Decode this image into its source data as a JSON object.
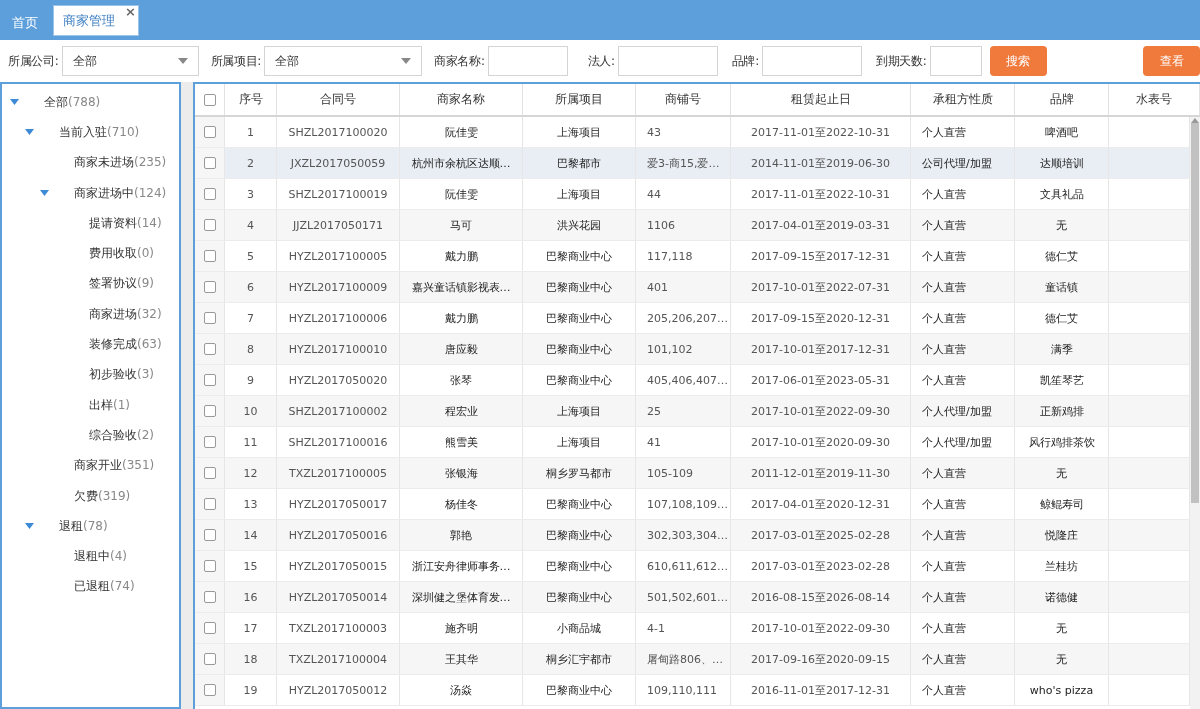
{
  "tabs": [
    {
      "label": "首页",
      "selected": false
    },
    {
      "label": "商家管理",
      "selected": true,
      "close": "×"
    }
  ],
  "filters": [
    {
      "kind": "select",
      "label": "所属公司:",
      "value": "全部"
    },
    {
      "kind": "select",
      "label": "所属项目:",
      "value": "全部"
    },
    {
      "kind": "input",
      "label": "商家名称:"
    },
    {
      "kind": "input",
      "label": "法人:"
    },
    {
      "kind": "input",
      "label": "品牌:"
    },
    {
      "kind": "short",
      "label": "到期天数:"
    }
  ],
  "search_button": "搜索",
  "view_button": "查看",
  "tree": [
    {
      "label": "全部",
      "count": "(788)",
      "expanded": true,
      "children": [
        {
          "label": "当前入驻",
          "count": "(710)",
          "expanded": true,
          "children": [
            {
              "label": "商家未进场",
              "count": "(235)"
            },
            {
              "label": "商家进场中",
              "count": "(124)",
              "expanded": true,
              "children": [
                {
                  "label": "提请资料",
                  "count": "(14)"
                },
                {
                  "label": "费用收取",
                  "count": "(0)"
                },
                {
                  "label": "签署协议",
                  "count": "(9)"
                },
                {
                  "label": "商家进场",
                  "count": "(32)"
                },
                {
                  "label": "装修完成",
                  "count": "(63)"
                },
                {
                  "label": "初步验收",
                  "count": "(3)"
                },
                {
                  "label": "出样",
                  "count": "(1)"
                },
                {
                  "label": "综合验收",
                  "count": "(2)"
                }
              ]
            },
            {
              "label": "商家开业",
              "count": "(351)"
            },
            {
              "label": "欠费",
              "count": "(319)"
            }
          ]
        },
        {
          "label": "退租",
          "count": "(78)",
          "expanded": true,
          "children": [
            {
              "label": "退租中",
              "count": "(4)"
            },
            {
              "label": "已退租",
              "count": "(74)"
            }
          ]
        }
      ]
    }
  ],
  "table": {
    "header_checked": false,
    "columns": [
      "序号",
      "合同号",
      "商家名称",
      "所属项目",
      "商铺号",
      "租赁起止日",
      "承租方性质",
      "品牌",
      "水表号"
    ],
    "rows": [
      {
        "checked": false,
        "selected": false,
        "cells": [
          "1",
          "SHZL2017100020",
          "阮佳雯",
          "上海项目",
          "43",
          "2017-11-01至2022-10-31",
          "个人直营",
          "啤酒吧"
        ]
      },
      {
        "checked": false,
        "selected": true,
        "cells": [
          "2",
          "JXZL2017050059",
          "杭州市余杭区达顺…",
          "巴黎都市",
          "爱3-商15,爱…",
          "2014-11-01至2019-06-30",
          "公司代理/加盟",
          "达顺培训"
        ]
      },
      {
        "checked": false,
        "selected": false,
        "cells": [
          "3",
          "SHZL2017100019",
          "阮佳雯",
          "上海项目",
          "44",
          "2017-11-01至2022-10-31",
          "个人直营",
          "文具礼品"
        ]
      },
      {
        "checked": false,
        "selected": false,
        "cells": [
          "4",
          "JJZL2017050171",
          "马可",
          "洪兴花园",
          "1106",
          "2017-04-01至2019-03-31",
          "个人直营",
          "无"
        ]
      },
      {
        "checked": false,
        "selected": false,
        "cells": [
          "5",
          "HYZL2017100005",
          "戴力鹏",
          "巴黎商业中心",
          "117,118",
          "2017-09-15至2017-12-31",
          "个人直营",
          "德仁艾"
        ]
      },
      {
        "checked": false,
        "selected": false,
        "cells": [
          "6",
          "HYZL2017100009",
          "嘉兴童话镇影视表…",
          "巴黎商业中心",
          "401",
          "2017-10-01至2022-07-31",
          "个人直营",
          "童话镇"
        ]
      },
      {
        "checked": false,
        "selected": false,
        "cells": [
          "7",
          "HYZL2017100006",
          "戴力鹏",
          "巴黎商业中心",
          "205,206,207…",
          "2017-09-15至2020-12-31",
          "个人直营",
          "德仁艾"
        ]
      },
      {
        "checked": false,
        "selected": false,
        "cells": [
          "8",
          "HYZL2017100010",
          "唐应毅",
          "巴黎商业中心",
          "101,102",
          "2017-10-01至2017-12-31",
          "个人直营",
          "满季"
        ]
      },
      {
        "checked": false,
        "selected": false,
        "cells": [
          "9",
          "HYZL2017050020",
          "张琴",
          "巴黎商业中心",
          "405,406,407…",
          "2017-06-01至2023-05-31",
          "个人直营",
          "凯笙琴艺"
        ]
      },
      {
        "checked": false,
        "selected": false,
        "cells": [
          "10",
          "SHZL2017100002",
          "程宏业",
          "上海项目",
          "25",
          "2017-10-01至2022-09-30",
          "个人代理/加盟",
          "正新鸡排"
        ]
      },
      {
        "checked": false,
        "selected": false,
        "cells": [
          "11",
          "SHZL2017100016",
          "熊雪美",
          "上海项目",
          "41",
          "2017-10-01至2020-09-30",
          "个人代理/加盟",
          "风行鸡排茶饮"
        ]
      },
      {
        "checked": false,
        "selected": false,
        "cells": [
          "12",
          "TXZL2017100005",
          "张银海",
          "桐乡罗马都市",
          "105-109",
          "2011-12-01至2019-11-30",
          "个人直营",
          "无"
        ]
      },
      {
        "checked": false,
        "selected": false,
        "cells": [
          "13",
          "HYZL2017050017",
          "杨佳冬",
          "巴黎商业中心",
          "107,108,109…",
          "2017-04-01至2020-12-31",
          "个人直营",
          "鲸鲲寿司"
        ]
      },
      {
        "checked": false,
        "selected": false,
        "cells": [
          "14",
          "HYZL2017050016",
          "郭艳",
          "巴黎商业中心",
          "302,303,304…",
          "2017-03-01至2025-02-28",
          "个人直营",
          "悦隆庄"
        ]
      },
      {
        "checked": false,
        "selected": false,
        "cells": [
          "15",
          "HYZL2017050015",
          "浙江安舟律师事务…",
          "巴黎商业中心",
          "610,611,612…",
          "2017-03-01至2023-02-28",
          "个人直营",
          "兰桂坊"
        ]
      },
      {
        "checked": false,
        "selected": false,
        "cells": [
          "16",
          "HYZL2017050014",
          "深圳健之堡体育发…",
          "巴黎商业中心",
          "501,502,601…",
          "2016-08-15至2026-08-14",
          "个人直营",
          "诺德健"
        ]
      },
      {
        "checked": false,
        "selected": false,
        "cells": [
          "17",
          "TXZL2017100003",
          "施齐明",
          "小商品城",
          "4-1",
          "2017-10-01至2022-09-30",
          "个人直营",
          "无"
        ]
      },
      {
        "checked": false,
        "selected": false,
        "cells": [
          "18",
          "TXZL2017100004",
          "王其华",
          "桐乡汇宇都市",
          "屠甸路806、…",
          "2017-09-16至2020-09-15",
          "个人直营",
          "无"
        ]
      },
      {
        "checked": false,
        "selected": false,
        "cells": [
          "19",
          "HYZL2017050012",
          "汤焱",
          "巴黎商业中心",
          "109,110,111",
          "2016-11-01至2017-12-31",
          "个人直营",
          "who's pizza"
        ]
      }
    ]
  }
}
